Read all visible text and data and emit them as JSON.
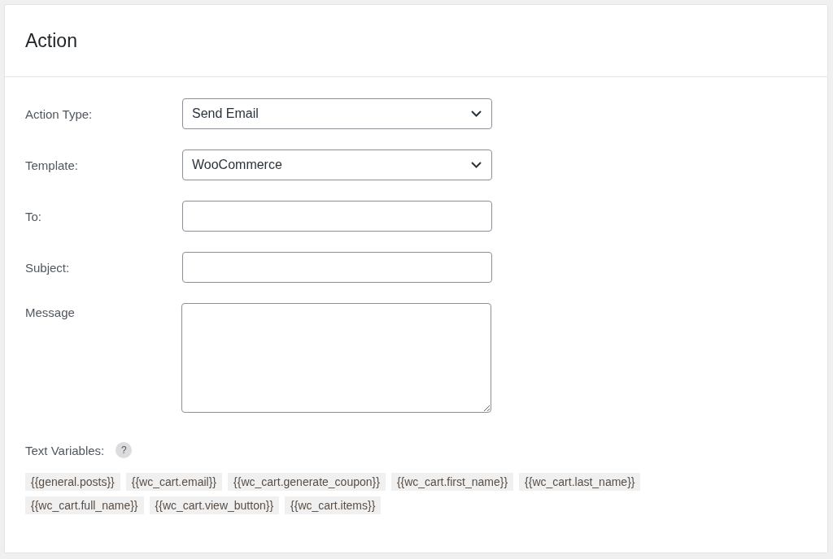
{
  "panel": {
    "title": "Action"
  },
  "fields": [
    {
      "kind": "select",
      "label": "Action Type:",
      "value": "Send Email"
    },
    {
      "kind": "select",
      "label": "Template:",
      "value": "WooCommerce"
    },
    {
      "kind": "text",
      "label": "To:"
    },
    {
      "kind": "text",
      "label": "Subject:"
    },
    {
      "kind": "textarea",
      "label": "Message"
    }
  ],
  "text_variables": {
    "label": "Text Variables:",
    "help": "?",
    "chips": [
      "{{general.posts}}",
      "{{wc_cart.email}}",
      "{{wc_cart.generate_coupon}}",
      "{{wc_cart.first_name}}",
      "{{wc_cart.last_name}}",
      "{{wc_cart.full_name}}",
      "{{wc_cart.view_button}}",
      "{{wc_cart.items}}"
    ]
  }
}
